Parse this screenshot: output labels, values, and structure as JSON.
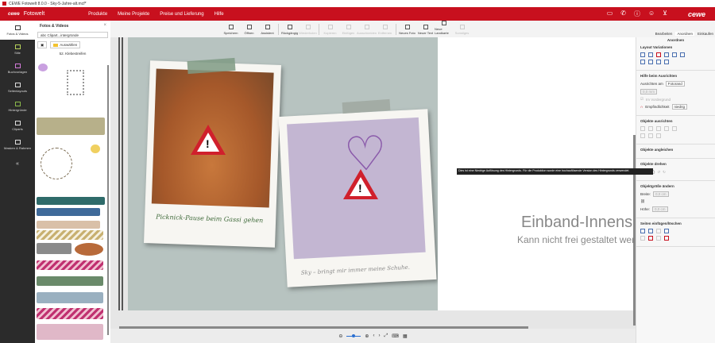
{
  "window": {
    "title": "CEWE Fotowelt 8.0.0 - Sky-5-Jahre-alt.mcf*"
  },
  "menu": {
    "logo": "cewe",
    "app": "Fotowelt",
    "items": [
      "Produkte",
      "Meine Projekte",
      "Preise und Lieferung",
      "Hilfe"
    ],
    "brand": "cewe"
  },
  "leftnav": [
    "Fotos & Videos",
    "Stile",
    "Buchvorlagen",
    "Seitenlayouts",
    "Hintergründe",
    "Cliparts",
    "Masken & Rahmen"
  ],
  "panel": {
    "title": "Fotos & Videos",
    "breadcrumb": "abc Clipart...intergründe",
    "select_label": "Auswählen",
    "category": "52. Klebestreifen"
  },
  "toolbar": {
    "buttons": [
      "Speichern",
      "Öffnen",
      "Assistent",
      "Rückgängig",
      "Wiederholen",
      "Kopieren",
      "Einfügen",
      "Ausschneiden",
      "Entfernen",
      "Neues Foto",
      "Neuer Text",
      "Neue Landkarte",
      "Sonstiges"
    ],
    "tabs": [
      "Bearbeiten",
      "Anordnen",
      "Einkaufen"
    ]
  },
  "canvas": {
    "caption1": "Picknick-Pause beim Gassi gehen",
    "caption2": "Sky – bringt mir immer meine Schuhe.",
    "right_title": "Einband-Innenseite",
    "right_sub": "Kann nicht frei gestaltet werden",
    "tooltip": "Dies ist eine Niedrige Auflösung des Hintergrunds. Für die Produktion wurde eine hochauflösende Version des Hintergrunds verwendet."
  },
  "right": {
    "header": "Anordnen",
    "layout": "Layout Variationen",
    "help": "Hilfe beim Ausrichten",
    "align_at": "Ausrichten am",
    "align_val": "Fotorand",
    "dist": "0,0 mm",
    "fg": "Im Vordergrund",
    "sens": "Empfindlichkeit",
    "sens_val": "niedrig",
    "objalign": "Objekte ausrichten",
    "objmatch": "Objekte angleichen",
    "rotate": "Objekte drehen",
    "rot_val": "0°",
    "size": "Objektgröße ändern",
    "width": "Breite:",
    "width_val": "0,0 cm",
    "height": "Höhe:",
    "height_val": "0,0 cm",
    "pages": "Seiten einfügen/löschen"
  }
}
